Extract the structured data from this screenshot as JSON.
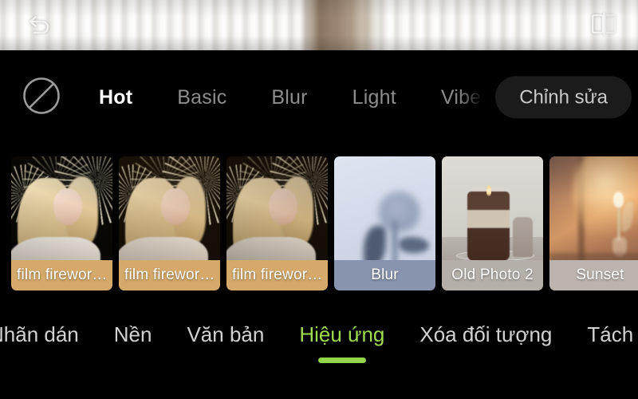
{
  "app": {
    "accent_green": "#93d64b",
    "background": "#000000"
  },
  "preview": {
    "undo_icon": "undo-arrow-icon",
    "compare_icon": "compare-split-icon",
    "description": "blurred white knit fabric photo"
  },
  "filters": {
    "none_icon": "no-filter-circle-slash-icon",
    "tabs": [
      {
        "label": "Hot",
        "active": true
      },
      {
        "label": "Basic",
        "active": false
      },
      {
        "label": "Blur",
        "active": false
      },
      {
        "label": "Light",
        "active": false
      },
      {
        "label": "Vibe",
        "active": false
      }
    ],
    "edit_button_label": "Chỉnh sửa",
    "thumbnails": [
      {
        "label": "film firewor…",
        "label_bg": "#d4a96a",
        "art": "fw"
      },
      {
        "label": "film firewor…",
        "label_bg": "#d4a96a",
        "art": "fw-warm"
      },
      {
        "label": "film firewor…",
        "label_bg": "#d4a96a",
        "art": "fw-warm2"
      },
      {
        "label": "Blur",
        "label_bg": "#8894ae",
        "art": "blur"
      },
      {
        "label": "Old Photo 2",
        "label_bg": "#b5afa9",
        "art": "old"
      },
      {
        "label": "Sunset",
        "label_bg": "#bdb3ae",
        "art": "sunset"
      }
    ]
  },
  "bottom_nav": {
    "items": [
      {
        "label": "Nhãn dán",
        "active": false
      },
      {
        "label": "Nền",
        "active": false
      },
      {
        "label": "Văn bản",
        "active": false
      },
      {
        "label": "Hiệu ứng",
        "active": true
      },
      {
        "label": "Xóa đối tượng",
        "active": false
      },
      {
        "label": "Tách nền",
        "active": false
      }
    ]
  }
}
